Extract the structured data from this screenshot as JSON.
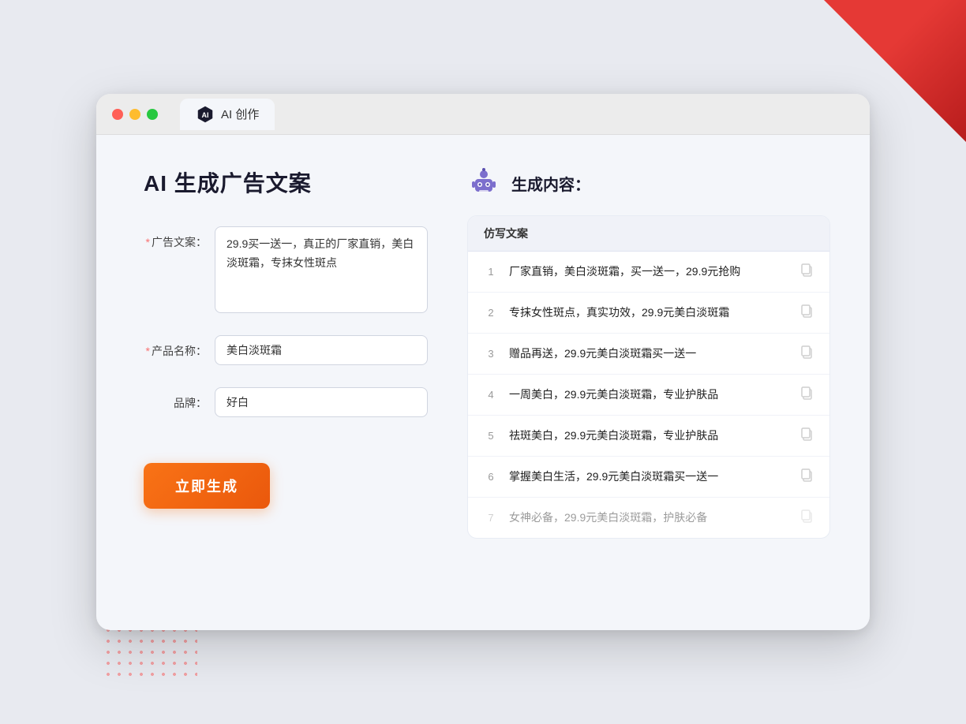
{
  "browser": {
    "tab_label": "AI 创作"
  },
  "page": {
    "title": "AI 生成广告文案",
    "right_title": "生成内容："
  },
  "form": {
    "ad_copy_label": "广告文案：",
    "ad_copy_required": "*",
    "ad_copy_value": "29.9买一送一，真正的厂家直销，美白淡斑霜，专抹女性斑点",
    "product_name_label": "产品名称：",
    "product_name_required": "*",
    "product_name_value": "美白淡斑霜",
    "brand_label": "品牌：",
    "brand_value": "好白",
    "generate_button": "立即生成"
  },
  "results": {
    "header": "仿写文案",
    "items": [
      {
        "num": "1",
        "text": "厂家直销，美白淡斑霜，买一送一，29.9元抢购",
        "faded": false
      },
      {
        "num": "2",
        "text": "专抹女性斑点，真实功效，29.9元美白淡斑霜",
        "faded": false
      },
      {
        "num": "3",
        "text": "赠品再送，29.9元美白淡斑霜买一送一",
        "faded": false
      },
      {
        "num": "4",
        "text": "一周美白，29.9元美白淡斑霜，专业护肤品",
        "faded": false
      },
      {
        "num": "5",
        "text": "祛斑美白，29.9元美白淡斑霜，专业护肤品",
        "faded": false
      },
      {
        "num": "6",
        "text": "掌握美白生活，29.9元美白淡斑霜买一送一",
        "faded": false
      },
      {
        "num": "7",
        "text": "女神必备，29.9元美白淡斑霜，护肤必备",
        "faded": true
      }
    ]
  }
}
